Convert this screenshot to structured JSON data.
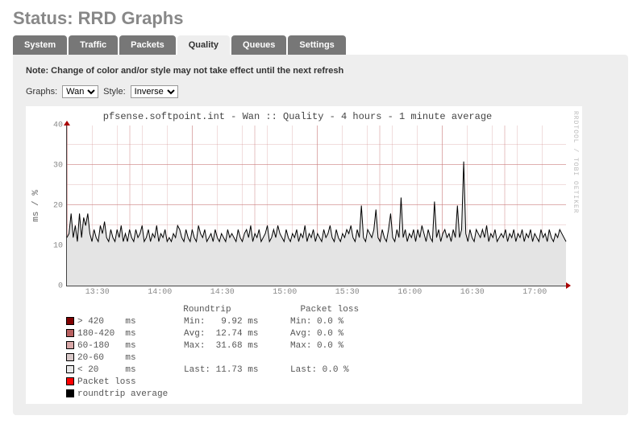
{
  "page_title": "Status: RRD Graphs",
  "tabs": [
    "System",
    "Traffic",
    "Packets",
    "Quality",
    "Queues",
    "Settings"
  ],
  "active_tab_index": 3,
  "note": "Note: Change of color and/or style may not take effect until the next refresh",
  "controls": {
    "graphs_label": "Graphs:",
    "graphs_value": "Wan",
    "style_label": "Style:",
    "style_value": "Inverse"
  },
  "chart_title": "pfsense.softpoint.int - Wan :: Quality - 4 hours - 1 minute average",
  "ylabel": "ms / %",
  "credit": "RRDTOOL / TOBI OETIKER",
  "legend": {
    "headers": {
      "roundtrip": "Roundtrip",
      "packetloss": "Packet loss"
    },
    "thresholds": [
      {
        "label": "> 420",
        "unit": "ms",
        "color": "#800000"
      },
      {
        "label": "180-420",
        "unit": "ms",
        "color": "#b86060"
      },
      {
        "label": "60-180",
        "unit": "ms",
        "color": "#d8a8a8"
      },
      {
        "label": "20-60",
        "unit": "ms",
        "color": "#d8c8c8"
      },
      {
        "label": "< 20",
        "unit": "ms",
        "color": "#e8e8e8"
      }
    ],
    "stats": {
      "roundtrip": {
        "Min": "9.92 ms",
        "Avg": "12.74 ms",
        "Max": "31.68 ms",
        "Last": "11.73 ms"
      },
      "packetloss": {
        "Min": "0.0 %",
        "Avg": "0.0 %",
        "Max": "0.0 %",
        "Last": "0.0 %"
      }
    },
    "packet_loss_label": "Packet loss",
    "roundtrip_avg_label": "roundtrip average",
    "packet_loss_color": "#ff0000",
    "roundtrip_avg_color": "#000000"
  },
  "chart_data": {
    "type": "area",
    "xlabel": "",
    "ylabel": "ms / %",
    "ylim": [
      0,
      40
    ],
    "y_ticks": [
      0,
      10,
      20,
      30,
      40
    ],
    "x_ticks": [
      "13:30",
      "14:00",
      "14:30",
      "15:00",
      "15:30",
      "16:00",
      "16:30",
      "17:00"
    ],
    "x_range_hours": 4,
    "series": [
      {
        "name": "roundtrip average",
        "unit": "ms",
        "values": [
          12,
          13,
          18,
          12,
          15,
          11,
          18,
          12,
          17,
          15,
          18,
          13,
          11,
          14,
          12,
          11,
          15,
          13,
          16,
          12,
          11,
          14,
          12,
          11,
          14,
          12,
          15,
          11,
          13,
          11,
          14,
          12,
          11,
          14,
          12,
          13,
          15,
          11,
          12,
          14,
          11,
          13,
          12,
          15,
          11,
          13,
          12,
          14,
          11,
          12,
          11,
          13,
          12,
          15,
          14,
          12,
          11,
          14,
          12,
          11,
          14,
          12,
          11,
          15,
          13,
          12,
          14,
          11,
          12,
          13,
          11,
          14,
          12,
          11,
          13,
          12,
          11,
          14,
          12,
          13,
          12,
          11,
          14,
          12,
          11,
          13,
          14,
          12,
          15,
          11,
          13,
          12,
          14,
          11,
          12,
          13,
          15,
          11,
          12,
          14,
          12,
          15,
          13,
          12,
          11,
          14,
          12,
          11,
          13,
          12,
          14,
          11,
          13,
          12,
          15,
          11,
          13,
          12,
          14,
          11,
          13,
          12,
          11,
          14,
          12,
          13,
          15,
          12,
          11,
          14,
          12,
          11,
          13,
          12,
          14,
          13,
          15,
          12,
          11,
          14,
          12,
          20,
          12,
          11,
          14,
          13,
          12,
          14,
          19,
          12,
          11,
          14,
          12,
          11,
          14,
          18,
          12,
          11,
          14,
          12,
          22,
          12,
          14,
          11,
          13,
          12,
          14,
          11,
          14,
          12,
          15,
          13,
          11,
          14,
          12,
          11,
          21,
          12,
          14,
          11,
          13,
          14,
          12,
          13,
          11,
          14,
          12,
          20,
          12,
          14,
          31,
          13,
          11,
          14,
          12,
          11,
          14,
          13,
          12,
          14,
          12,
          15,
          11,
          13,
          12,
          14,
          11,
          12,
          13,
          12,
          14,
          11,
          13,
          12,
          14,
          11,
          13,
          12,
          14,
          11,
          13,
          12,
          14,
          11,
          13,
          12,
          11,
          14,
          12,
          13,
          11,
          14,
          12,
          11,
          13,
          12,
          14,
          13,
          12,
          11
        ]
      },
      {
        "name": "Packet loss",
        "unit": "%",
        "values_constant": 0.0
      }
    ]
  }
}
